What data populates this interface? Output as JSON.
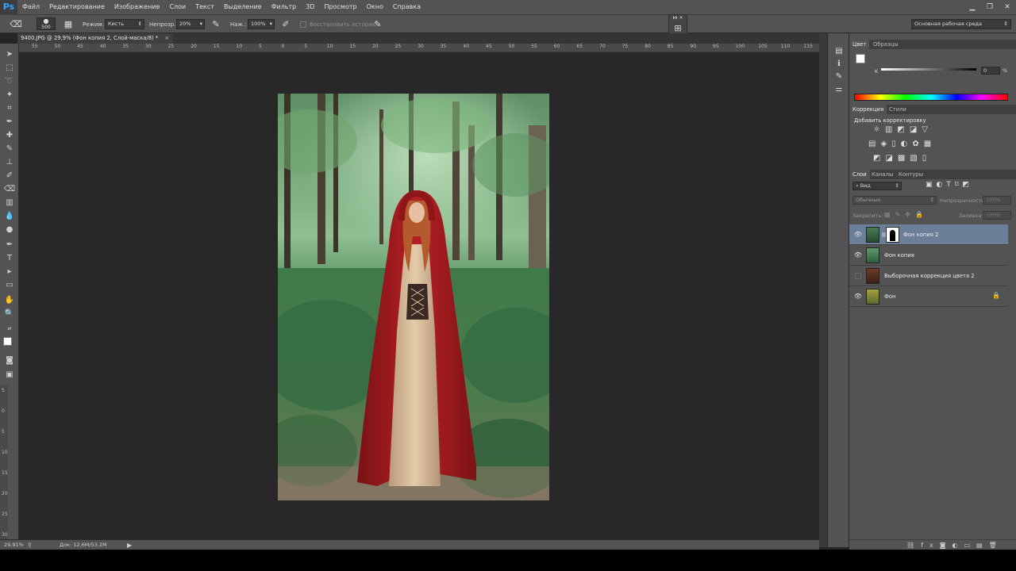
{
  "menu": {
    "logo": "Ps",
    "items": [
      "Файл",
      "Редактирование",
      "Изображение",
      "Слои",
      "Текст",
      "Выделение",
      "Фильтр",
      "3D",
      "Просмотр",
      "Окно",
      "Справка"
    ]
  },
  "options": {
    "brush_size": "500",
    "mode_label": "Режим:",
    "mode_value": "Кисть",
    "opacity_label": "Непрозр.:",
    "opacity_value": "20%",
    "flow_label": "Наж.:",
    "flow_value": "100%",
    "restore_history": "Восстановить историю",
    "workspace": "Основная рабочая среда"
  },
  "document": {
    "tab_title": "9400.JPG @ 29,9% (Фон копия 2, Слой-маска/8) *",
    "close_glyph": "×"
  },
  "ruler": {
    "h_ticks": [
      "55",
      "50",
      "45",
      "40",
      "35",
      "30",
      "25",
      "20",
      "15",
      "10",
      "5",
      "0",
      "5",
      "10",
      "15",
      "20",
      "25",
      "30",
      "35",
      "40",
      "45",
      "50",
      "55",
      "60",
      "65",
      "70",
      "75",
      "80",
      "85",
      "90",
      "95",
      "100",
      "105",
      "110",
      "115"
    ],
    "v_ticks": [
      "5",
      "0",
      "5",
      "10",
      "15",
      "20",
      "25",
      "30"
    ]
  },
  "status": {
    "zoom": "29,91%",
    "doc_info": "Док: 12,6M/53,2M"
  },
  "color_panel": {
    "tab_color": "Цвет",
    "tab_swatches": "Образцы",
    "k_label": "K",
    "k_value": "0",
    "percent": "%"
  },
  "adjust_panel": {
    "tab_correction": "Коррекция",
    "tab_styles": "Стили",
    "heading": "Добавить корректировку"
  },
  "layers_panel": {
    "tab_layers": "Слои",
    "tab_channels": "Каналы",
    "tab_paths": "Контуры",
    "filter_kind": "Вид",
    "blend_mode": "Обычные",
    "opacity_label": "Непрозрачность:",
    "opacity_value": "100%",
    "lock_label": "Закрепить:",
    "fill_label": "Заливка:",
    "fill_value": "100%",
    "layers": [
      {
        "name": "Фон копия 2",
        "visible": true,
        "selected": true
      },
      {
        "name": "Фон копия",
        "visible": true,
        "selected": false
      },
      {
        "name": "Выборочная коррекция цвета 2",
        "visible": false,
        "selected": false
      },
      {
        "name": "Фон",
        "visible": true,
        "selected": false
      }
    ]
  },
  "colors": {
    "accent_blue": "#31a8ff",
    "selection_row": "#6c7f99",
    "cloak_red": "#a3191c",
    "forest_green": "#3f7a4a"
  }
}
